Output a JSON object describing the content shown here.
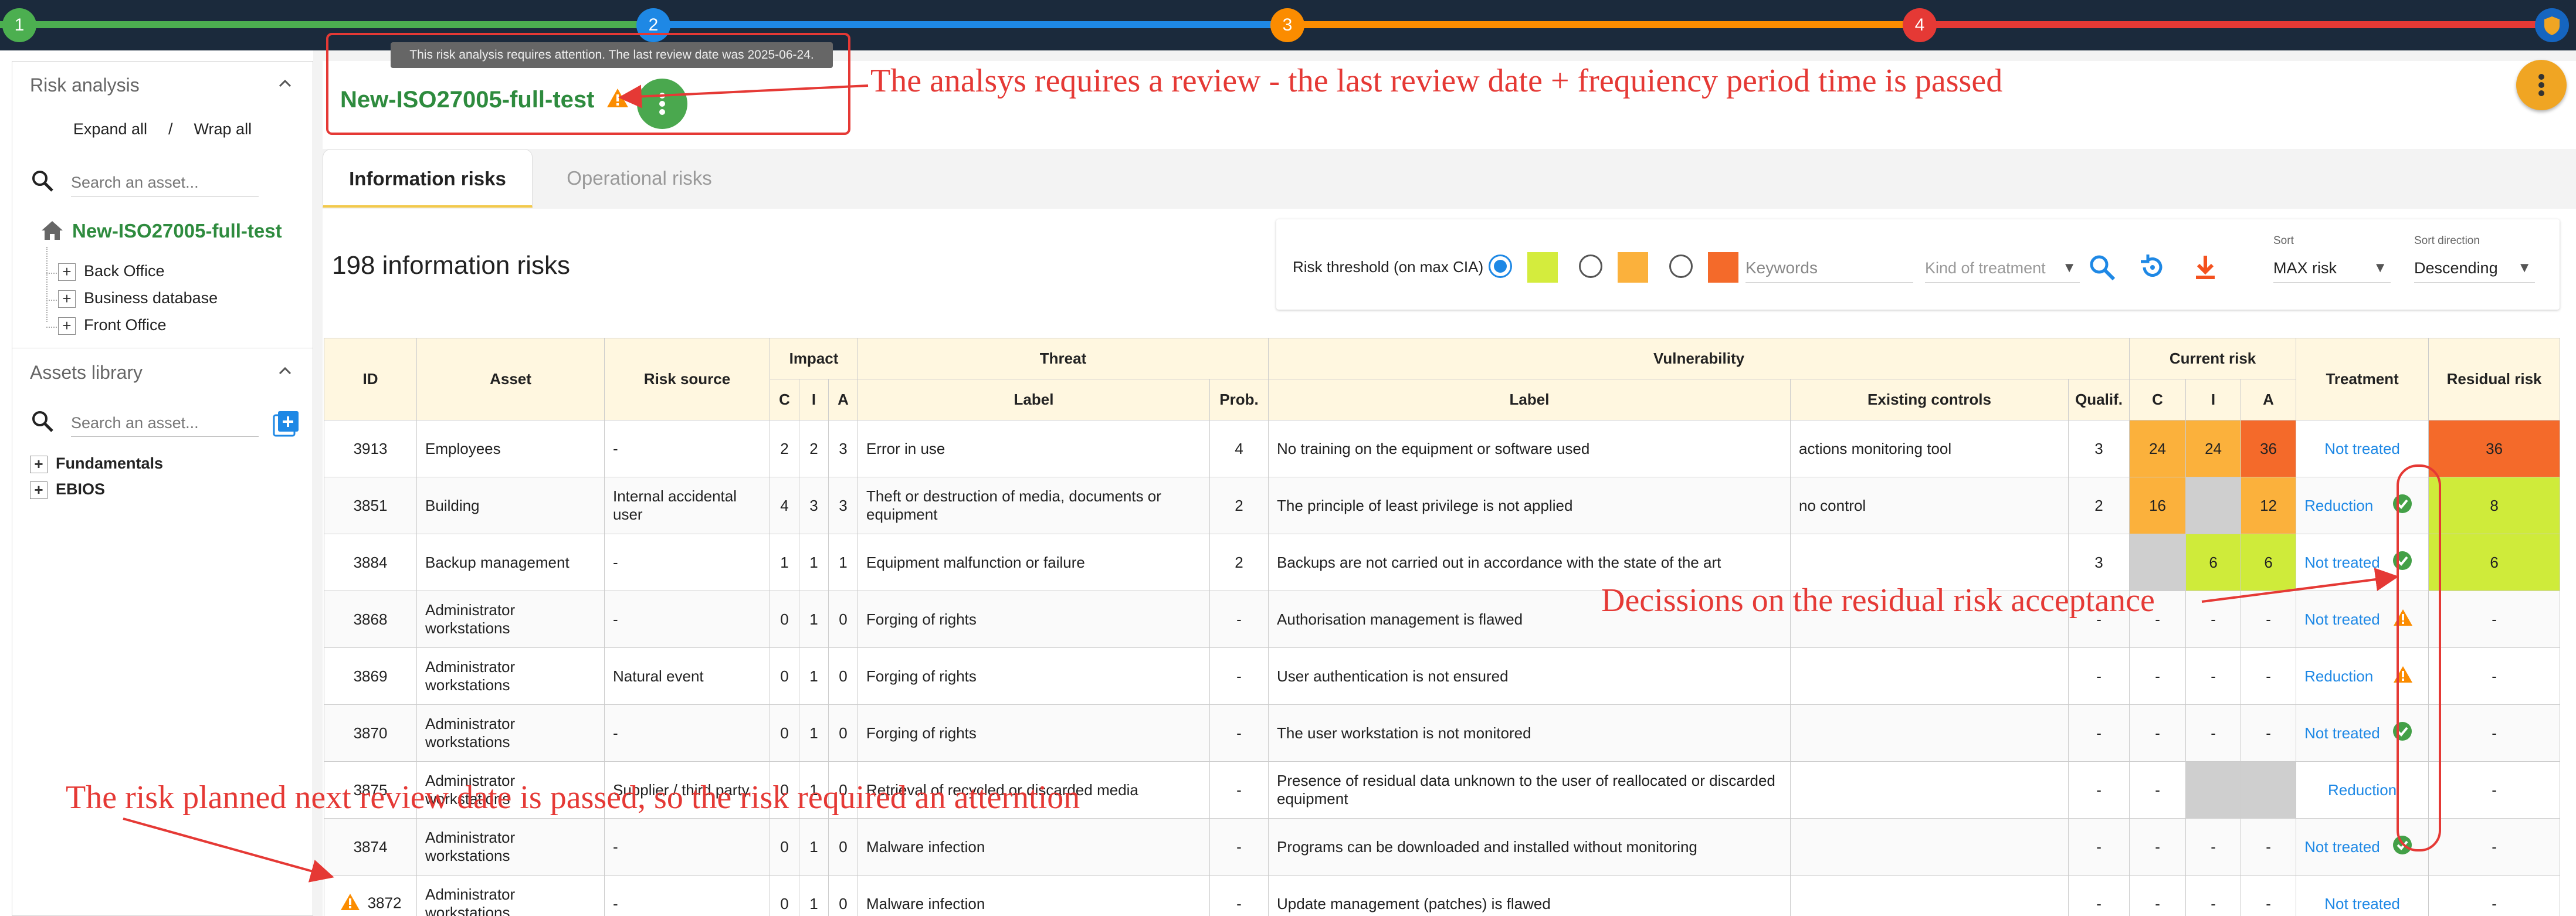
{
  "stepper": {
    "steps": [
      "1",
      "2",
      "3",
      "4"
    ],
    "colors": [
      "#4caf50",
      "#1e88e5",
      "#fb8c00",
      "#e53935"
    ]
  },
  "sidebar": {
    "risk_panel_title": "Risk analysis",
    "expand_all": "Expand all",
    "separator": "/",
    "wrap_all": "Wrap all",
    "search_placeholder": "Search an asset...",
    "root_label": "New-ISO27005-full-test",
    "tree_items": [
      "Back Office",
      "Business database",
      "Front Office"
    ],
    "library_title": "Assets library",
    "library_search_placeholder": "Search an asset...",
    "library_items": [
      "Fundamentals",
      "EBIOS"
    ]
  },
  "header": {
    "tooltip": "This risk analysis requires attention. The last review date was 2025-06-24.",
    "analysis_title": "New-ISO27005-full-test"
  },
  "tabs": {
    "information": "Information risks",
    "operational": "Operational risks"
  },
  "summary": {
    "count_label": "198 information risks"
  },
  "filters": {
    "threshold_label": "Risk threshold (on max CIA)",
    "threshold_colors": [
      "#d4ec3d",
      "#fbb13c",
      "#f46a2a"
    ],
    "keywords_placeholder": "Keywords",
    "treatment_placeholder": "Kind of treatment",
    "sort_label": "Sort",
    "sort_value": "MAX risk",
    "direction_label": "Sort direction",
    "direction_value": "Descending"
  },
  "table": {
    "group_headers": {
      "impact": "Impact",
      "threat": "Threat",
      "vulnerability": "Vulnerability",
      "current_risk": "Current risk"
    },
    "headers": {
      "id": "ID",
      "asset": "Asset",
      "risk_source": "Risk source",
      "c": "C",
      "i": "I",
      "a": "A",
      "threat_label": "Label",
      "prob": "Prob.",
      "vuln_label": "Label",
      "controls": "Existing controls",
      "qualif": "Qualif.",
      "cr_c": "C",
      "cr_i": "I",
      "cr_a": "A",
      "treatment": "Treatment",
      "residual": "Residual risk"
    },
    "rows": [
      {
        "id": "3913",
        "asset": "Employees",
        "source": "-",
        "c": "2",
        "i": "2",
        "a": "3",
        "threat": "Error in use",
        "prob": "4",
        "vuln": "No training on the equipment or software used",
        "controls": "actions monitoring tool",
        "qualif": "3",
        "rc": "24",
        "ri": "24",
        "ra": "36",
        "treatment": "Not treated",
        "residual": "36",
        "rc_col": "orange",
        "ri_col": "orange",
        "ra_col": "red",
        "res_col": "red",
        "icon": "",
        "flag": false
      },
      {
        "id": "3851",
        "asset": "Building",
        "source": "Internal accidental user",
        "c": "4",
        "i": "3",
        "a": "3",
        "threat": "Theft or destruction of media, documents or equipment",
        "prob": "2",
        "vuln": "The principle of least privilege is not applied",
        "controls": "no control",
        "qualif": "2",
        "rc": "16",
        "ri": "",
        "ra": "12",
        "treatment": "Reduction",
        "residual": "8",
        "rc_col": "orange",
        "ri_col": "grey",
        "ra_col": "orange",
        "res_col": "lime",
        "icon": "check",
        "flag": false
      },
      {
        "id": "3884",
        "asset": "Backup management",
        "source": "-",
        "c": "1",
        "i": "1",
        "a": "1",
        "threat": "Equipment malfunction or failure",
        "prob": "2",
        "vuln": "Backups are not carried out in accordance with the state of the art",
        "controls": "",
        "qualif": "3",
        "rc": "",
        "ri": "6",
        "ra": "6",
        "treatment": "Not treated",
        "residual": "6",
        "rc_col": "grey",
        "ri_col": "lime",
        "ra_col": "lime",
        "res_col": "lime",
        "icon": "check",
        "flag": false
      },
      {
        "id": "3868",
        "asset": "Administrator workstations",
        "source": "-",
        "c": "0",
        "i": "1",
        "a": "0",
        "threat": "Forging of rights",
        "prob": "-",
        "vuln": "Authorisation management is flawed",
        "controls": "",
        "qualif": "-",
        "rc": "-",
        "ri": "-",
        "ra": "-",
        "treatment": "Not treated",
        "residual": "-",
        "rc_col": "",
        "ri_col": "",
        "ra_col": "",
        "res_col": "",
        "icon": "warn",
        "flag": false
      },
      {
        "id": "3869",
        "asset": "Administrator workstations",
        "source": "Natural event",
        "c": "0",
        "i": "1",
        "a": "0",
        "threat": "Forging of rights",
        "prob": "-",
        "vuln": "User authentication is not ensured",
        "controls": "",
        "qualif": "-",
        "rc": "-",
        "ri": "-",
        "ra": "-",
        "treatment": "Reduction",
        "residual": "-",
        "rc_col": "",
        "ri_col": "",
        "ra_col": "",
        "res_col": "",
        "icon": "warn",
        "flag": false
      },
      {
        "id": "3870",
        "asset": "Administrator workstations",
        "source": "-",
        "c": "0",
        "i": "1",
        "a": "0",
        "threat": "Forging of rights",
        "prob": "-",
        "vuln": "The user workstation is not monitored",
        "controls": "",
        "qualif": "-",
        "rc": "-",
        "ri": "-",
        "ra": "-",
        "treatment": "Not treated",
        "residual": "-",
        "rc_col": "",
        "ri_col": "",
        "ra_col": "",
        "res_col": "",
        "icon": "check",
        "flag": false
      },
      {
        "id": "3875",
        "asset": "Administrator workstations",
        "source": "Supplier / third party",
        "c": "0",
        "i": "1",
        "a": "0",
        "threat": "Retrieval of recycled or discarded media",
        "prob": "-",
        "vuln": "Presence of residual data unknown to the user of reallocated or discarded equipment",
        "controls": "",
        "qualif": "-",
        "rc": "-",
        "ri": "",
        "ra": "",
        "treatment": "Reduction",
        "residual": "-",
        "rc_col": "",
        "ri_col": "grey",
        "ra_col": "grey",
        "res_col": "",
        "icon": "",
        "flag": false
      },
      {
        "id": "3874",
        "asset": "Administrator workstations",
        "source": "-",
        "c": "0",
        "i": "1",
        "a": "0",
        "threat": "Malware infection",
        "prob": "-",
        "vuln": "Programs can be downloaded and installed without monitoring",
        "controls": "",
        "qualif": "-",
        "rc": "-",
        "ri": "-",
        "ra": "-",
        "treatment": "Not treated",
        "residual": "-",
        "rc_col": "",
        "ri_col": "",
        "ra_col": "",
        "res_col": "",
        "icon": "check",
        "flag": false
      },
      {
        "id": "3872",
        "asset": "Administrator workstations",
        "source": "-",
        "c": "0",
        "i": "1",
        "a": "0",
        "threat": "Malware infection",
        "prob": "-",
        "vuln": "Update management (patches) is flawed",
        "controls": "",
        "qualif": "-",
        "rc": "-",
        "ri": "-",
        "ra": "-",
        "treatment": "Not treated",
        "residual": "-",
        "rc_col": "",
        "ri_col": "",
        "ra_col": "",
        "res_col": "",
        "icon": "",
        "flag": true
      }
    ]
  },
  "annotations": {
    "review": "The analsys requires a review - the last review date + frequiency period time is passed",
    "decisions": "Decissions on the residual risk acceptance",
    "next_review": "The risk planned next review date is passed, so the risk required an atterntion",
    "color": "#e53935"
  }
}
